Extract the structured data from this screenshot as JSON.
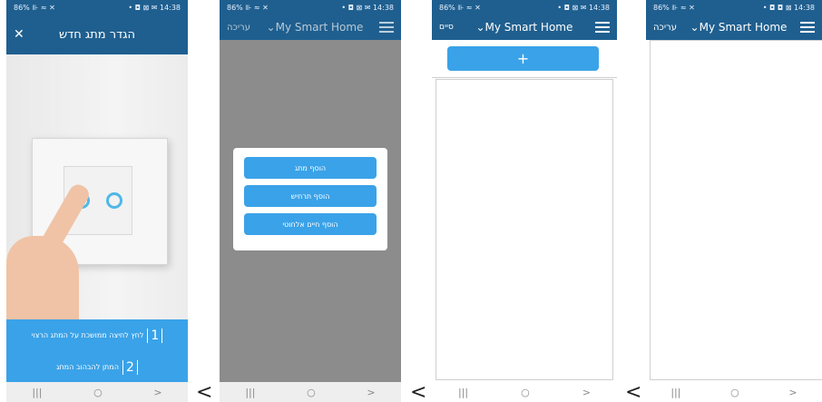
{
  "screens": {
    "s1": {
      "status_left": "86% ⊪ ≈ ✕",
      "status_right": "• ◘ ⊠ ✉ 14:38",
      "title": "הגדר מתג חדש",
      "step1_text": "לחץ לחיצה ממושכת על המתג הרצוי",
      "step1_num": "1",
      "step2_text": "המתן להבהוב המתג",
      "step2_num": "2"
    },
    "s2": {
      "status_left": "86% ⊪ ≈ ✕",
      "status_right": "• ◘ ⊠ ✉ 14:38",
      "edit_label": "עריכה",
      "home_title": "My Smart Home",
      "menu_items": [
        "הוסף מתג",
        "הוסף תרחיש",
        "הוסף חיים אלחוטי"
      ]
    },
    "s3": {
      "status_left": "86% ⊪ ≈ ✕",
      "status_right": "• ◘ ⊠ ✉ 14:38",
      "done_label": "סיים",
      "home_title": "My Smart Home",
      "add_label": "+"
    },
    "s4": {
      "status_left": "86% ⊪ ≈ ✕",
      "status_right": "• ◘ ◘ ⊠ 14:38",
      "edit_label": "עריכה",
      "home_title": "My Smart Home"
    }
  },
  "nav": {
    "recents": "|||",
    "home": "○",
    "back": ">"
  },
  "separator": "<",
  "colors": {
    "header": "#1f5f8f",
    "button": "#3aa2e8",
    "overlay": "#8c8c8c"
  }
}
